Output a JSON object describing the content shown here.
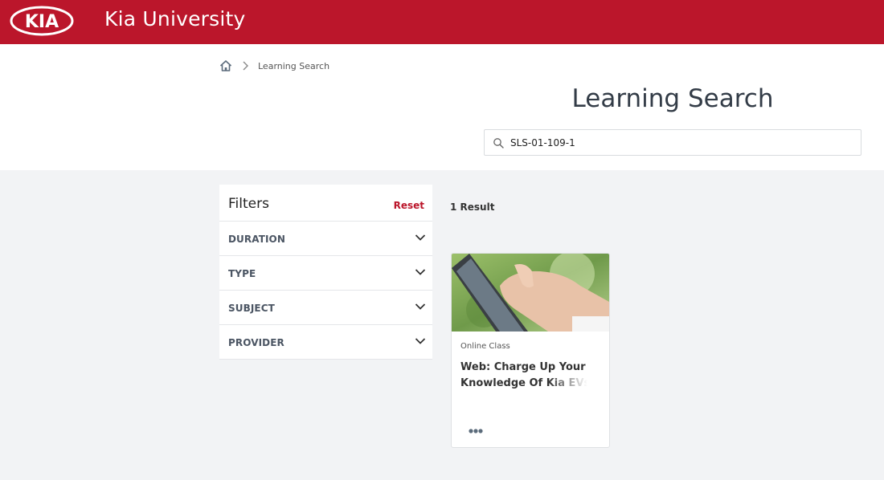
{
  "header": {
    "logo_text": "KIA",
    "title": "Kia University",
    "bg_color": "#bb162b"
  },
  "breadcrumb": {
    "home_icon": "home-icon",
    "current": "Learning Search"
  },
  "page": {
    "title": "Learning Search"
  },
  "search": {
    "value": "SLS-01-109-1"
  },
  "filters": {
    "title": "Filters",
    "reset_label": "Reset",
    "items": [
      {
        "label": "DURATION"
      },
      {
        "label": "TYPE"
      },
      {
        "label": "SUBJECT"
      },
      {
        "label": "PROVIDER"
      }
    ]
  },
  "results": {
    "count_label": "1 Result",
    "items": [
      {
        "type": "Online Class",
        "title": "Web: Charge Up Your Knowledge Of Kia EVs"
      }
    ]
  }
}
